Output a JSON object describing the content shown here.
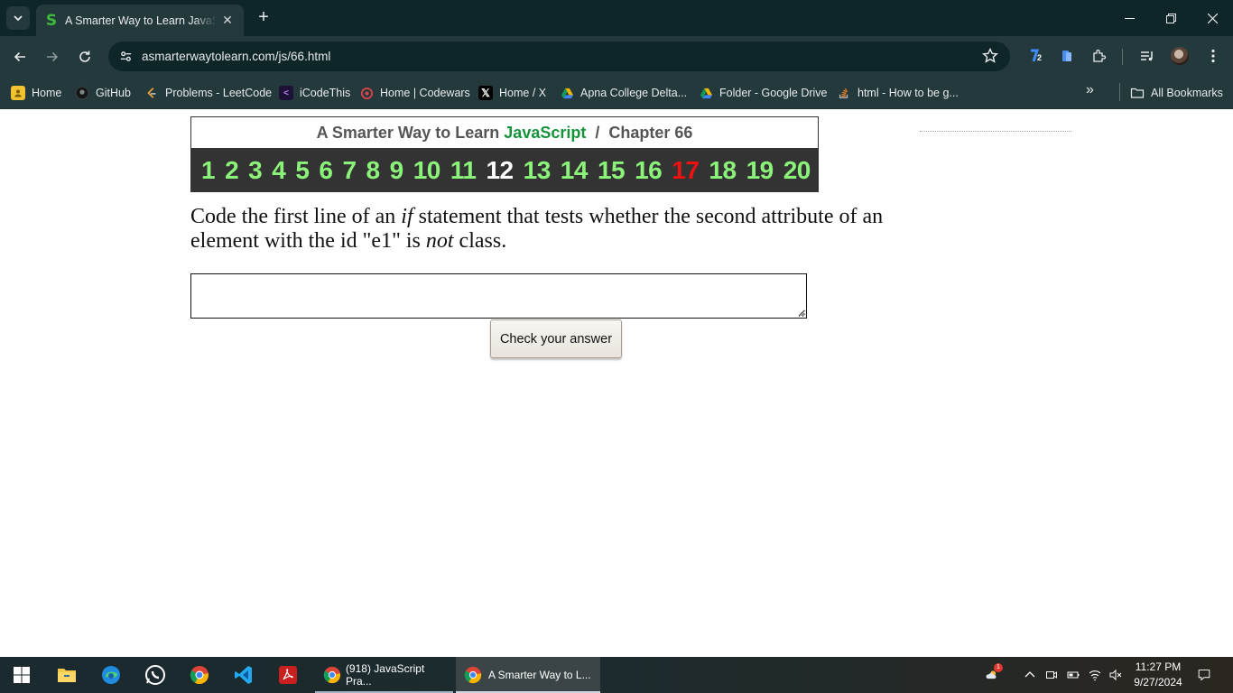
{
  "browser": {
    "tab_title": "A Smarter Way to Learn JavaScript",
    "tab_favicon": "S",
    "url": "asmarterwaytolearn.com/js/66.html",
    "bookmarks": [
      {
        "label": "Home",
        "icon": "home-folder-icon"
      },
      {
        "label": "GitHub",
        "icon": "github-icon"
      },
      {
        "label": "Problems - LeetCode",
        "icon": "leetcode-icon"
      },
      {
        "label": "iCodeThis",
        "icon": "icodethis-icon"
      },
      {
        "label": "Home | Codewars",
        "icon": "codewars-icon"
      },
      {
        "label": "Home / X",
        "icon": "x-icon"
      },
      {
        "label": "Apna College Delta...",
        "icon": "google-drive-icon"
      },
      {
        "label": "Folder - Google Drive",
        "icon": "google-drive-icon"
      },
      {
        "label": "html - How to be g...",
        "icon": "stackoverflow-icon"
      }
    ],
    "all_bookmarks_label": "All Bookmarks",
    "extension_badge": "2"
  },
  "page": {
    "site_name": "A Smarter Way to Learn",
    "language": "JavaScript",
    "separator": "/",
    "chapter_label": "Chapter 66",
    "chapter_links": [
      "1",
      "2",
      "3",
      "4",
      "5",
      "6",
      "7",
      "8",
      "9",
      "10",
      "11",
      "12",
      "13",
      "14",
      "15",
      "16",
      "17",
      "18",
      "19",
      "20"
    ],
    "current_chapter": "12",
    "highlighted_chapter": "17",
    "question": {
      "part1": "Code the first line of an ",
      "em1": "if",
      "part2": " statement that tests whether the second attribute of an element with the id \"e1\" is ",
      "em2": "not",
      "part3": " class."
    },
    "answer_value": "",
    "check_button_label": "Check your answer"
  },
  "taskbar": {
    "apps": [
      {
        "label": "(918) JavaScript Pra..."
      },
      {
        "label": "A Smarter Way to L..."
      }
    ],
    "time": "11:27 PM",
    "date": "9/27/2024",
    "weather_badge": "1"
  },
  "colors": {
    "chrome_dark": "#0f2628",
    "chrome": "#23393b",
    "chapter_green": "#8cf37a",
    "brand_green": "#15943a",
    "chapter_red": "#ee1111"
  }
}
